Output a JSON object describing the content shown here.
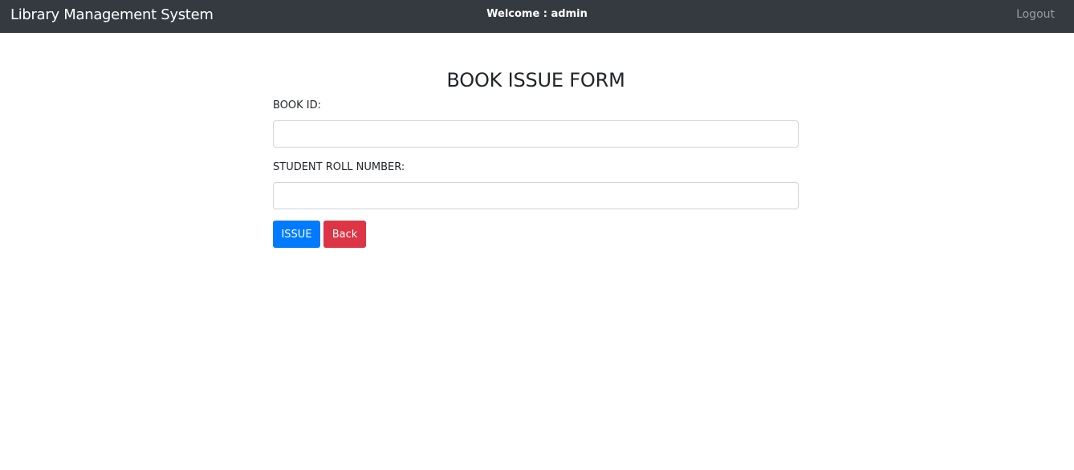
{
  "navbar": {
    "brand": "Library Management System",
    "welcome": "Welcome : admin",
    "logout": "Logout"
  },
  "form": {
    "title": "BOOK ISSUE FORM",
    "book_id_label": "BOOK ID:",
    "book_id_value": "",
    "book_id_placeholder": "",
    "roll_label": "STUDENT ROLL NUMBER:",
    "roll_value": "",
    "roll_placeholder": "",
    "issue_button": "ISSUE",
    "back_button": "Back"
  },
  "colors": {
    "navbar_bg": "#343a40",
    "primary": "#007bff",
    "danger": "#dc3545"
  }
}
